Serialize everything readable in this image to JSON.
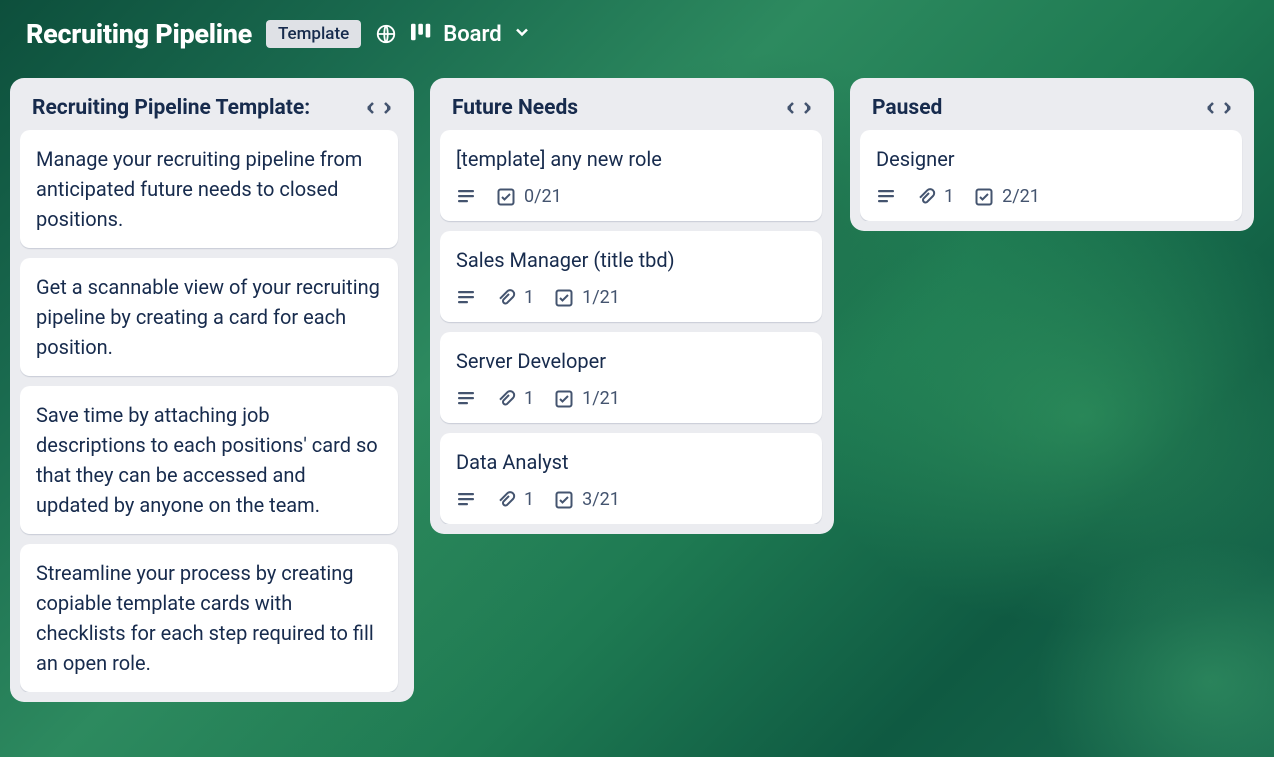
{
  "header": {
    "title": "Recruiting Pipeline",
    "template_badge": "Template",
    "view_label": "Board"
  },
  "lists": [
    {
      "title": "Recruiting Pipeline Template:",
      "cards": [
        {
          "title": "Manage your recruiting pipeline from anticipated future needs to closed positions."
        },
        {
          "title": "Get a scannable view of your recruiting pipeline by creating a card for each position."
        },
        {
          "title": "Save time by attaching job descriptions to each positions' card so that they can be accessed and updated by anyone on the team."
        },
        {
          "title": "Streamline your process by creating copiable template cards with checklists for each step required to fill an open role."
        }
      ]
    },
    {
      "title": "Future Needs",
      "cards": [
        {
          "title": "[template] any new role",
          "has_description": true,
          "checklist": "0/21"
        },
        {
          "title": "Sales Manager (title tbd)",
          "has_description": true,
          "attachments": "1",
          "checklist": "1/21"
        },
        {
          "title": "Server Developer",
          "has_description": true,
          "attachments": "1",
          "checklist": "1/21"
        },
        {
          "title": "Data Analyst",
          "has_description": true,
          "attachments": "1",
          "checklist": "3/21"
        }
      ]
    },
    {
      "title": "Paused",
      "cards": [
        {
          "title": "Designer",
          "has_description": true,
          "attachments": "1",
          "checklist": "2/21"
        }
      ]
    }
  ]
}
